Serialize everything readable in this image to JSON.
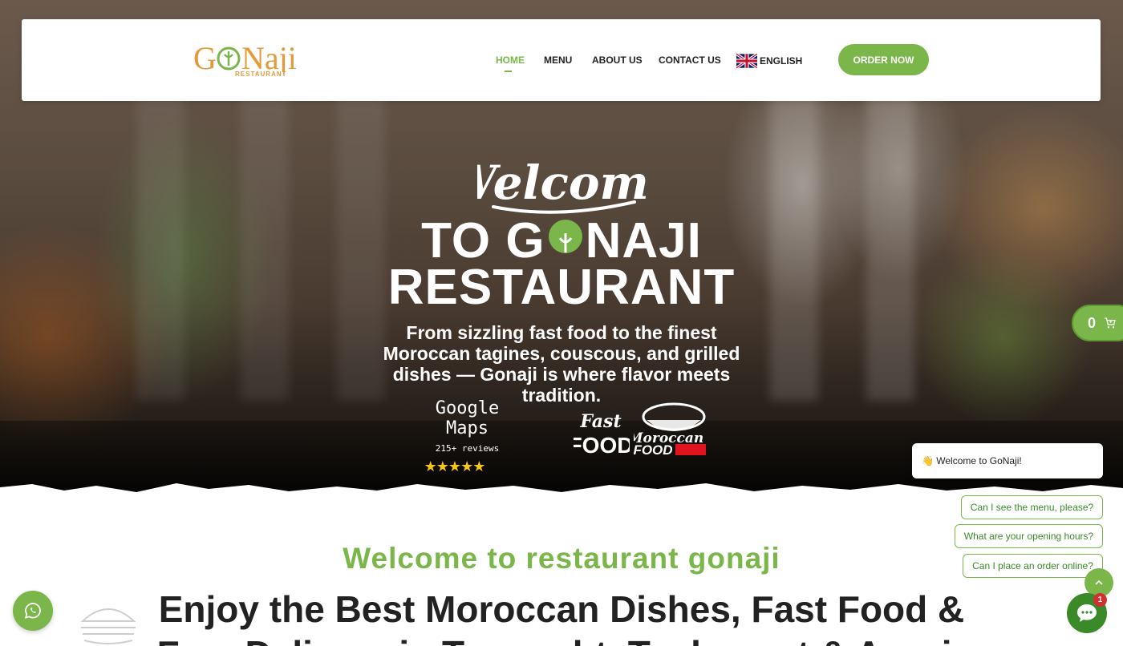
{
  "header": {
    "logo_text": "GoNaji",
    "logo_sub": "RESTAURANT",
    "nav": {
      "home": "HOME",
      "menu": "MENU",
      "about": "ABOUT US",
      "contact": "CONTACT US"
    },
    "language": "ENGLISH",
    "order_button": "ORDER NOW"
  },
  "hero": {
    "script_title": "Welcome",
    "title_line1_a": "TO G",
    "title_line1_b": "NAJI",
    "title_line2": "RESTAURANT",
    "subtitle": "From sizzling fast food to the finest Moroccan tagines, couscous, and grilled dishes — Gonaji is where flavor meets tradition.",
    "google_maps": {
      "label": "Google Maps",
      "reviews": "215+ reviews",
      "stars": "★★★★★",
      "rating": 5
    },
    "badges": [
      "Fast Food",
      "Moroccan Food"
    ]
  },
  "cart": {
    "count": "0"
  },
  "content": {
    "welcome": "Welcome to restaurant gonaji",
    "heading": "Enjoy the Best Moroccan Dishes, Fast Food & Free Delivery in Tamraght, Taghazout & Aourir"
  },
  "chat": {
    "greeting": "👋 Welcome to GoNaji!",
    "suggestions": [
      "Can I see the menu, please?",
      "What are your opening hours?",
      "Can I place an order online?"
    ],
    "unread": "1"
  },
  "colors": {
    "brand_green": "#7ab649",
    "brand_orange": "#e39a3a"
  },
  "icons": [
    "whatsapp-icon",
    "chat-icon",
    "cart-icon",
    "chevron-up-icon",
    "uk-flag-icon"
  ]
}
